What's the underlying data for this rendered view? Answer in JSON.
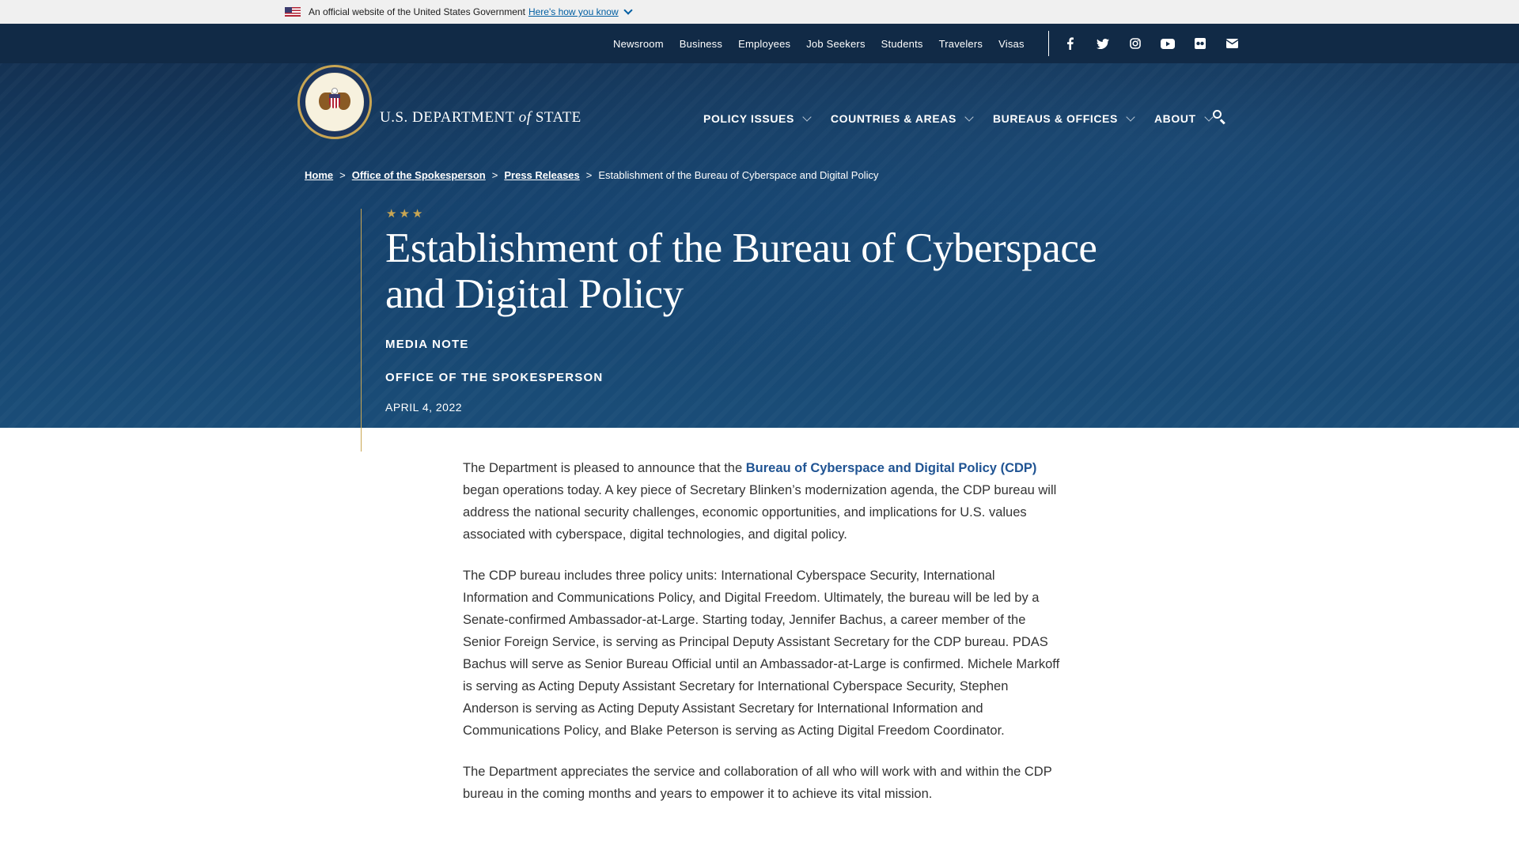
{
  "gov_banner": {
    "text": "An official website of the United States Government",
    "link": "Here's how you know"
  },
  "utility_nav": [
    "Newsroom",
    "Business",
    "Employees",
    "Job Seekers",
    "Students",
    "Travelers",
    "Visas"
  ],
  "social_icons": [
    "facebook-icon",
    "twitter-icon",
    "instagram-icon",
    "youtube-icon",
    "flickr-icon",
    "email-icon"
  ],
  "brand": {
    "prefix": "U.S. DEPARTMENT",
    "of": "of",
    "suffix": "STATE"
  },
  "main_nav": [
    "POLICY ISSUES",
    "COUNTRIES & AREAS",
    "BUREAUS & OFFICES",
    "ABOUT"
  ],
  "breadcrumb": {
    "items": [
      "Home",
      "Office of the Spokesperson",
      "Press Releases"
    ],
    "current": "Establishment of the Bureau of Cyberspace and Digital Policy",
    "separator": ">"
  },
  "hero": {
    "stars": "★★★",
    "title": "Establishment of the Bureau of Cyberspace and Digital Policy",
    "type": "MEDIA NOTE",
    "office": "OFFICE OF THE SPOKESPERSON",
    "date": "APRIL 4, 2022"
  },
  "article": {
    "p1_before": "The Department is pleased to announce that the ",
    "p1_link": "Bureau of Cyberspace and Digital Policy (CDP)",
    "p1_after": " began operations today. A key piece of Secretary Blinken’s modernization agenda, the CDP bureau will address the national security challenges, economic opportunities, and implications for U.S. values associated with cyberspace, digital technologies, and digital policy.",
    "p2": "The CDP bureau includes three policy units: International Cyberspace Security, International Information and Communications Policy, and Digital Freedom. Ultimately, the bureau will be led by a Senate-confirmed Ambassador-at-Large. Starting today, Jennifer Bachus, a career member of the Senior Foreign Service, is serving as Principal Deputy Assistant Secretary for the CDP bureau. PDAS Bachus will serve as Senior Bureau Official until an Ambassador-at-Large is confirmed. Michele Markoff is serving as Acting Deputy Assistant Secretary for International Cyberspace Security, Stephen Anderson is serving as Acting Deputy Assistant Secretary for International Information and Communications Policy, and Blake Peterson is serving as Acting Digital Freedom Coordinator.",
    "p3": "The Department appreciates the service and collaboration of all who will work with and within the CDP bureau in the coming months and years to empower it to achieve its vital mission."
  },
  "colors": {
    "hero_dark": "#132d4c",
    "utility_bar": "#112a46",
    "gold_accent": "#c9a653",
    "link_blue": "#205493",
    "gov_link": "#005ea2"
  }
}
